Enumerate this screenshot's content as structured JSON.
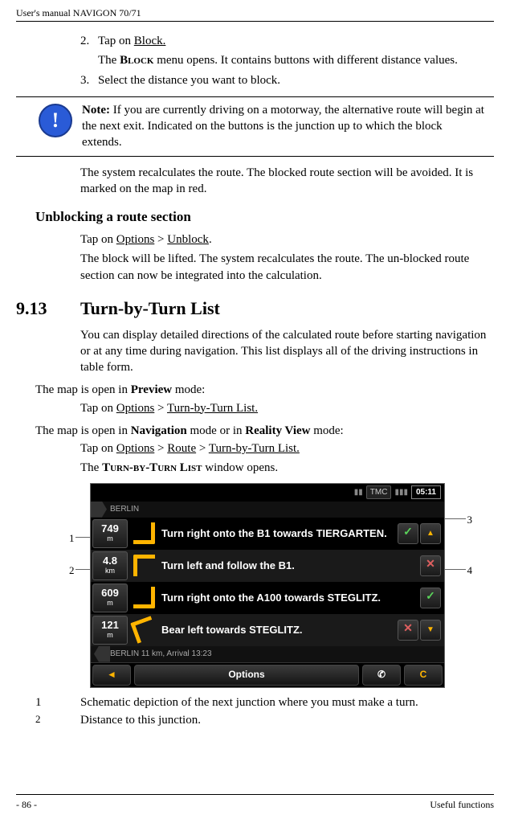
{
  "header": "User's manual NAVIGON 70/71",
  "step2_num": "2.",
  "step2_lead": "Tap on ",
  "step2_link": "Block.",
  "step2_body_a": "The ",
  "step2_body_sc": "Block",
  "step2_body_b": " menu opens. It contains buttons with different distance values.",
  "step3_num": "3.",
  "step3_txt": "Select the distance you want to block.",
  "note_label": "Note:",
  "note_body": " If you are currently driving on a motorway, the alternative route will begin at the next exit. Indicated on the buttons is the junction up to which the block extends.",
  "after_note": "The system recalculates the route. The blocked route section will be avoided. It is marked on the map in red.",
  "unblock_h": "Unblocking a route section",
  "unblock_a": "Tap on ",
  "unblock_opt": "Options",
  "unblock_gt": " > ",
  "unblock_ub": "Unblock",
  "unblock_dot": ".",
  "unblock_body": "The block will be lifted. The system recalculates the route. The un-blocked route section can now be integrated into the calculation.",
  "sec_num": "9.13",
  "sec_title": "Turn-by-Turn List",
  "sec_body": "You can display detailed directions of the calculated route before starting navigation or at any time during navigation. This list displays all of the driving instructions in table form.",
  "mapopen1_a": "The map is open in ",
  "mapopen1_b": "Preview",
  "mapopen1_c": " mode:",
  "mapopen1_tap_a": "Tap on ",
  "mapopen1_tap_opt": "Options",
  "mapopen1_tap_gt": " > ",
  "mapopen1_tap_link": "Turn-by-Turn List.",
  "mapopen2_a": "The map is open in ",
  "mapopen2_b": "Navigation",
  "mapopen2_c": " mode or in ",
  "mapopen2_d": "Reality View",
  "mapopen2_e": " mode:",
  "mapopen2_tap_a": "Tap on ",
  "mapopen2_tap_opt": "Options",
  "mapopen2_gt1": " > ",
  "mapopen2_route": "Route",
  "mapopen2_gt2": " > ",
  "mapopen2_link": "Turn-by-Turn List.",
  "window_a": "The ",
  "window_sc": "Turn-by-Turn List",
  "window_b": " window opens.",
  "shot": {
    "tmc": "TMC",
    "time": "05:11",
    "crumb_top": "BERLIN",
    "rows": [
      {
        "dist": "749",
        "unit": "m",
        "text": "Turn right onto the B1 towards TIERGARTEN."
      },
      {
        "dist": "4.8",
        "unit": "km",
        "text": "Turn left and follow the B1."
      },
      {
        "dist": "609",
        "unit": "m",
        "text": "Turn right onto the A100 towards STEGLITZ."
      },
      {
        "dist": "121",
        "unit": "m",
        "text": "Bear left towards STEGLITZ."
      }
    ],
    "crumb_bottom": "BERLIN 11 km, Arrival 13:23",
    "btn_options": "Options",
    "btn_phone": "✆",
    "btn_refresh": "C"
  },
  "callouts": {
    "c1": "1",
    "c2": "2",
    "c3": "3",
    "c4": "4"
  },
  "legend1_n": "1",
  "legend1_t": "Schematic depiction of the next junction where you must make a turn.",
  "legend2_n": "2",
  "legend2_t": "Distance to this junction.",
  "footer_left": "- 86 -",
  "footer_right": "Useful functions"
}
